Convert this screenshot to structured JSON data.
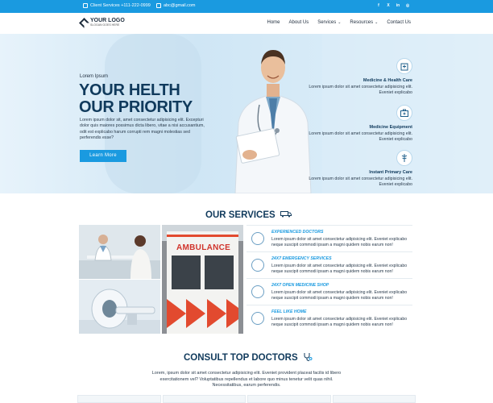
{
  "topbar": {
    "phone": "Client Services +111-222-0999",
    "email": "abc@gmail.com",
    "social": [
      "f",
      "X",
      "in",
      "ig"
    ]
  },
  "header": {
    "logo_title": "YOUR LOGO",
    "logo_slogan": "SLOGAN GOES HERE",
    "nav": [
      "Home",
      "About Us",
      "Services",
      "Resources",
      "Contact Us"
    ]
  },
  "hero": {
    "eyebrow": "Lorem Ipsum",
    "title_line1": "YOUR HELTH",
    "title_line2": "OUR PRIORITY",
    "text": "Lorem ipsum dolor sit, amet consectetur adipisicing elit. Excepturi dolor quis maiores possimus dicta libero, vitae a nisi accusantium, odit est explicabo harum corrupti rem magni molestias sed perferendis esse?",
    "button": "Learn More",
    "features": [
      {
        "title": "Medicine & Health Care",
        "text": "Lorem ipsum dolor sit amet consectetur adipisicing elit. Eveniet explicabo"
      },
      {
        "title": "Medicine Equipment",
        "text": "Lorem ipsum dolor sit amet consectetur adipisicing elit. Eveniet explicabo"
      },
      {
        "title": "Instant Primary Care",
        "text": "Lorem ipsum dolor sit amet consectetur adipisicing elit. Eveniet explicabo"
      }
    ]
  },
  "services": {
    "title": "OUR SERVICES",
    "items": [
      {
        "title": "EXPERIENCED DOCTORS",
        "text": "Lorem ipsum dolor sit amet consectetur adipisicing elit. Eveniet explicabo neque suscipit commodi ipsam a magni quidem nobis earum non!"
      },
      {
        "title": "24X7 EMERGENCY SERVICES",
        "text": "Lorem ipsum dolor sit amet consectetur adipisicing elit. Eveniet explicabo neque suscipit commodi ipsam a magni quidem nobis earum non!"
      },
      {
        "title": "24X7 OPEN MEDICINE SHOP",
        "text": "Lorem ipsum dolor sit amet consectetur adipisicing elit. Eveniet explicabo neque suscipit commodi ipsam a magni quidem nobis earum non!"
      },
      {
        "title": "FEEL LIKE HOME",
        "text": "Lorem ipsum dolor sit amet consectetur adipisicing elit. Eveniet explicabo neque suscipit commodi ipsam a magni quidem nobis earum non!"
      }
    ],
    "ambulance_label": "AMBULANCE"
  },
  "consult": {
    "title": "CONSULT TOP DOCTORS",
    "text": "Lorem, ipsum dolor sit amet consectetur adipisicing elit. Eveniet provident placeat facilis id libero exercitationem vel? Voluptatibus repellendus et labore quo minus tenetur velit quas nihil. Necessitatibus, earum perferendis."
  },
  "colors": {
    "accent": "#1a9ae0",
    "heading": "#103a5c"
  }
}
